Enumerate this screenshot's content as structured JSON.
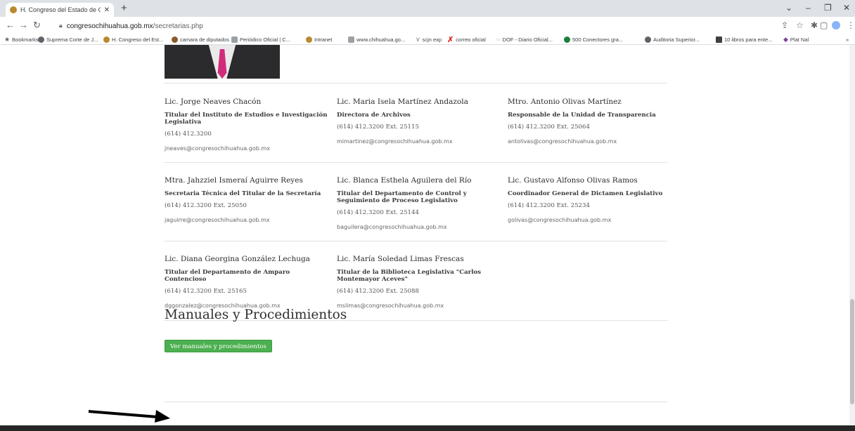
{
  "browser": {
    "tab_title": "H. Congreso del Estado de Chihu",
    "tab_close": "✕",
    "new_tab": "+",
    "url_host": "congresochihuahua.gob.mx",
    "url_path": "/secretarias.php",
    "bookmarks": [
      {
        "label": "Bookmarks",
        "icon": "star-icon",
        "color": "#5f6368"
      },
      {
        "label": "Suprema Corte de J...",
        "icon": "globe-icon",
        "color": "#5f6368"
      },
      {
        "label": "H. Congreso del Est...",
        "icon": "congreso-icon",
        "color": "#b9892f"
      },
      {
        "label": "camara de diputados",
        "icon": "camara-icon",
        "color": "#8a5a2b"
      },
      {
        "label": "Periódico Oficial | C...",
        "icon": "shield-icon",
        "color": "#7a7a7a"
      },
      {
        "label": "Intranet",
        "icon": "congreso-icon",
        "color": "#b9892f"
      },
      {
        "label": "www.chihuahua.go...",
        "icon": "shield-icon",
        "color": "#7a7a7a"
      },
      {
        "label": "scjn exp",
        "icon": "scjn-icon",
        "color": "#5f6368"
      },
      {
        "label": "correo oficial",
        "icon": "x-mark-icon",
        "color": "#d93025"
      },
      {
        "label": "DOF - Diario Oficial...",
        "icon": "dof-icon",
        "color": "#9aa0a6"
      },
      {
        "label": "500 Conectores gra...",
        "icon": "link-icon",
        "color": "#188038"
      },
      {
        "label": "Auditoria Superior...",
        "icon": "globe-icon",
        "color": "#5f6368"
      },
      {
        "label": "10 libros para ente...",
        "icon": "book-icon",
        "color": "#3c4043"
      },
      {
        "label": "Plat Nal",
        "icon": "diamond-icon",
        "color": "#7b3fa0"
      }
    ],
    "more_bookmarks": "»"
  },
  "staff": [
    {
      "name": "Lic. Jorge Neaves Chacón",
      "role": "Titular del Instituto de Estudios e Investigación Legislativa",
      "phone": "(614) 412.3200",
      "email": "jneaves@congresochihuahua.gob.mx"
    },
    {
      "name": "Lic. Maria Isela Martínez Andazola",
      "role": "Directora de Archivos",
      "phone": "(614) 412.3200 Ext. 25115",
      "email": "mimartinez@congresochihuahua.gob.mx"
    },
    {
      "name": "Mtro. Antonio Olivas Martínez",
      "role": "Responsable de la Unidad de Transparencia",
      "phone": "(614) 412.3200 Ext. 25064",
      "email": "antolivas@congresochihuahua.gob.mx"
    },
    {
      "name": "Mtra. Jahzziel Ismeraí Aguirre Reyes",
      "role": "Secretaria Técnica del Titular de la Secretaría",
      "phone": "(614) 412.3200 Ext. 25050",
      "email": "jaguirre@congresochihuahua.gob.mx"
    },
    {
      "name": "Lic. Blanca Esthela Aguilera del Río",
      "role": "Titular del Departamento de Control y Seguimiento de Proceso Legislativo",
      "phone": "(614) 412.3200 Ext. 25144",
      "email": "baguilera@congresochihuahua.gob.mx"
    },
    {
      "name": "Lic. Gustavo Alfonso Olivas Ramos",
      "role": "Coordinador General de Dictamen Legislativo",
      "phone": "(614) 412.3200 Ext. 25234",
      "email": "golivas@congresochihuahua.gob.mx"
    },
    {
      "name": "Lic. Diana Georgina González Lechuga",
      "role": "Titular del Departamento de Amparo Contencioso",
      "phone": "(614) 412.3200 Ext. 25165",
      "email": "dggonzalez@congresochihuahua.gob.mx"
    },
    {
      "name": "Lic. María Soledad Limas Frescas",
      "role": "Titular de la Biblioteca Legislativa \"Carlos Montemayor Aceves\"",
      "phone": "(614) 412.3200 Ext. 25088",
      "email": "mslimas@congresochihuahua.gob.mx"
    }
  ],
  "manuals": {
    "title": "Manuales y Procedimientos",
    "button_label": "Ver manuales y procedimientos"
  },
  "colors": {
    "button_green": "#4caf50",
    "footer": "#262626",
    "tie": "#d12c7a"
  }
}
